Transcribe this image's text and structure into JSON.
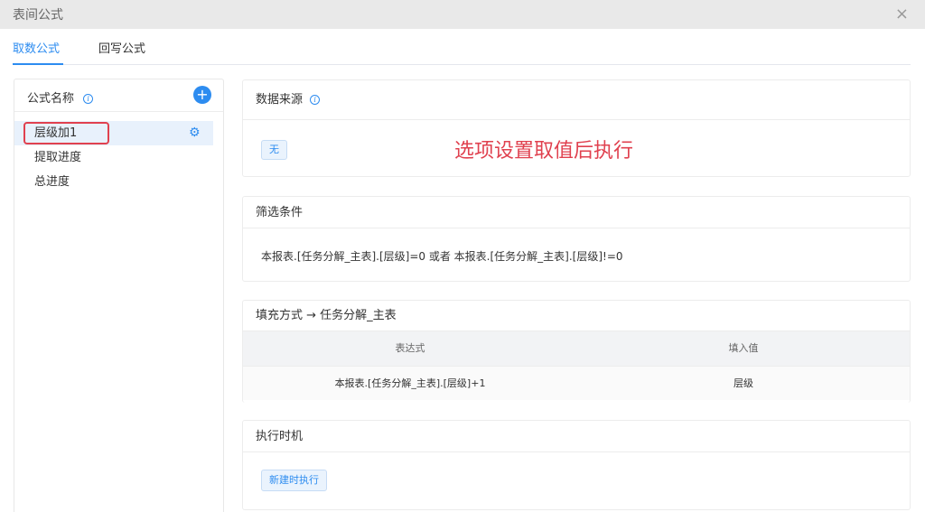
{
  "dialog": {
    "title": "表间公式",
    "close": "×"
  },
  "tabs": [
    {
      "label": "取数公式"
    },
    {
      "label": "回写公式"
    }
  ],
  "left": {
    "header": "公式名称",
    "items": [
      {
        "label": "层级加1"
      },
      {
        "label": "提取进度"
      },
      {
        "label": "总进度"
      }
    ]
  },
  "datasource": {
    "title": "数据来源",
    "value": "无",
    "annotation": "选项设置取值后执行"
  },
  "filter": {
    "title": "筛选条件",
    "text": "本报表.[任务分解_主表].[层级]=0 或者 本报表.[任务分解_主表].[层级]!=0"
  },
  "fill": {
    "title": "填充方式 → 任务分解_主表",
    "columns": [
      "表达式",
      "填入值"
    ],
    "rows": [
      {
        "expr": "本报表.[任务分解_主表].[层级]+1",
        "target": "层级"
      }
    ]
  },
  "timing": {
    "title": "执行时机",
    "value": "新建时执行"
  },
  "colors": {
    "accent": "#2d8cf0",
    "annotation": "#e0414f"
  }
}
